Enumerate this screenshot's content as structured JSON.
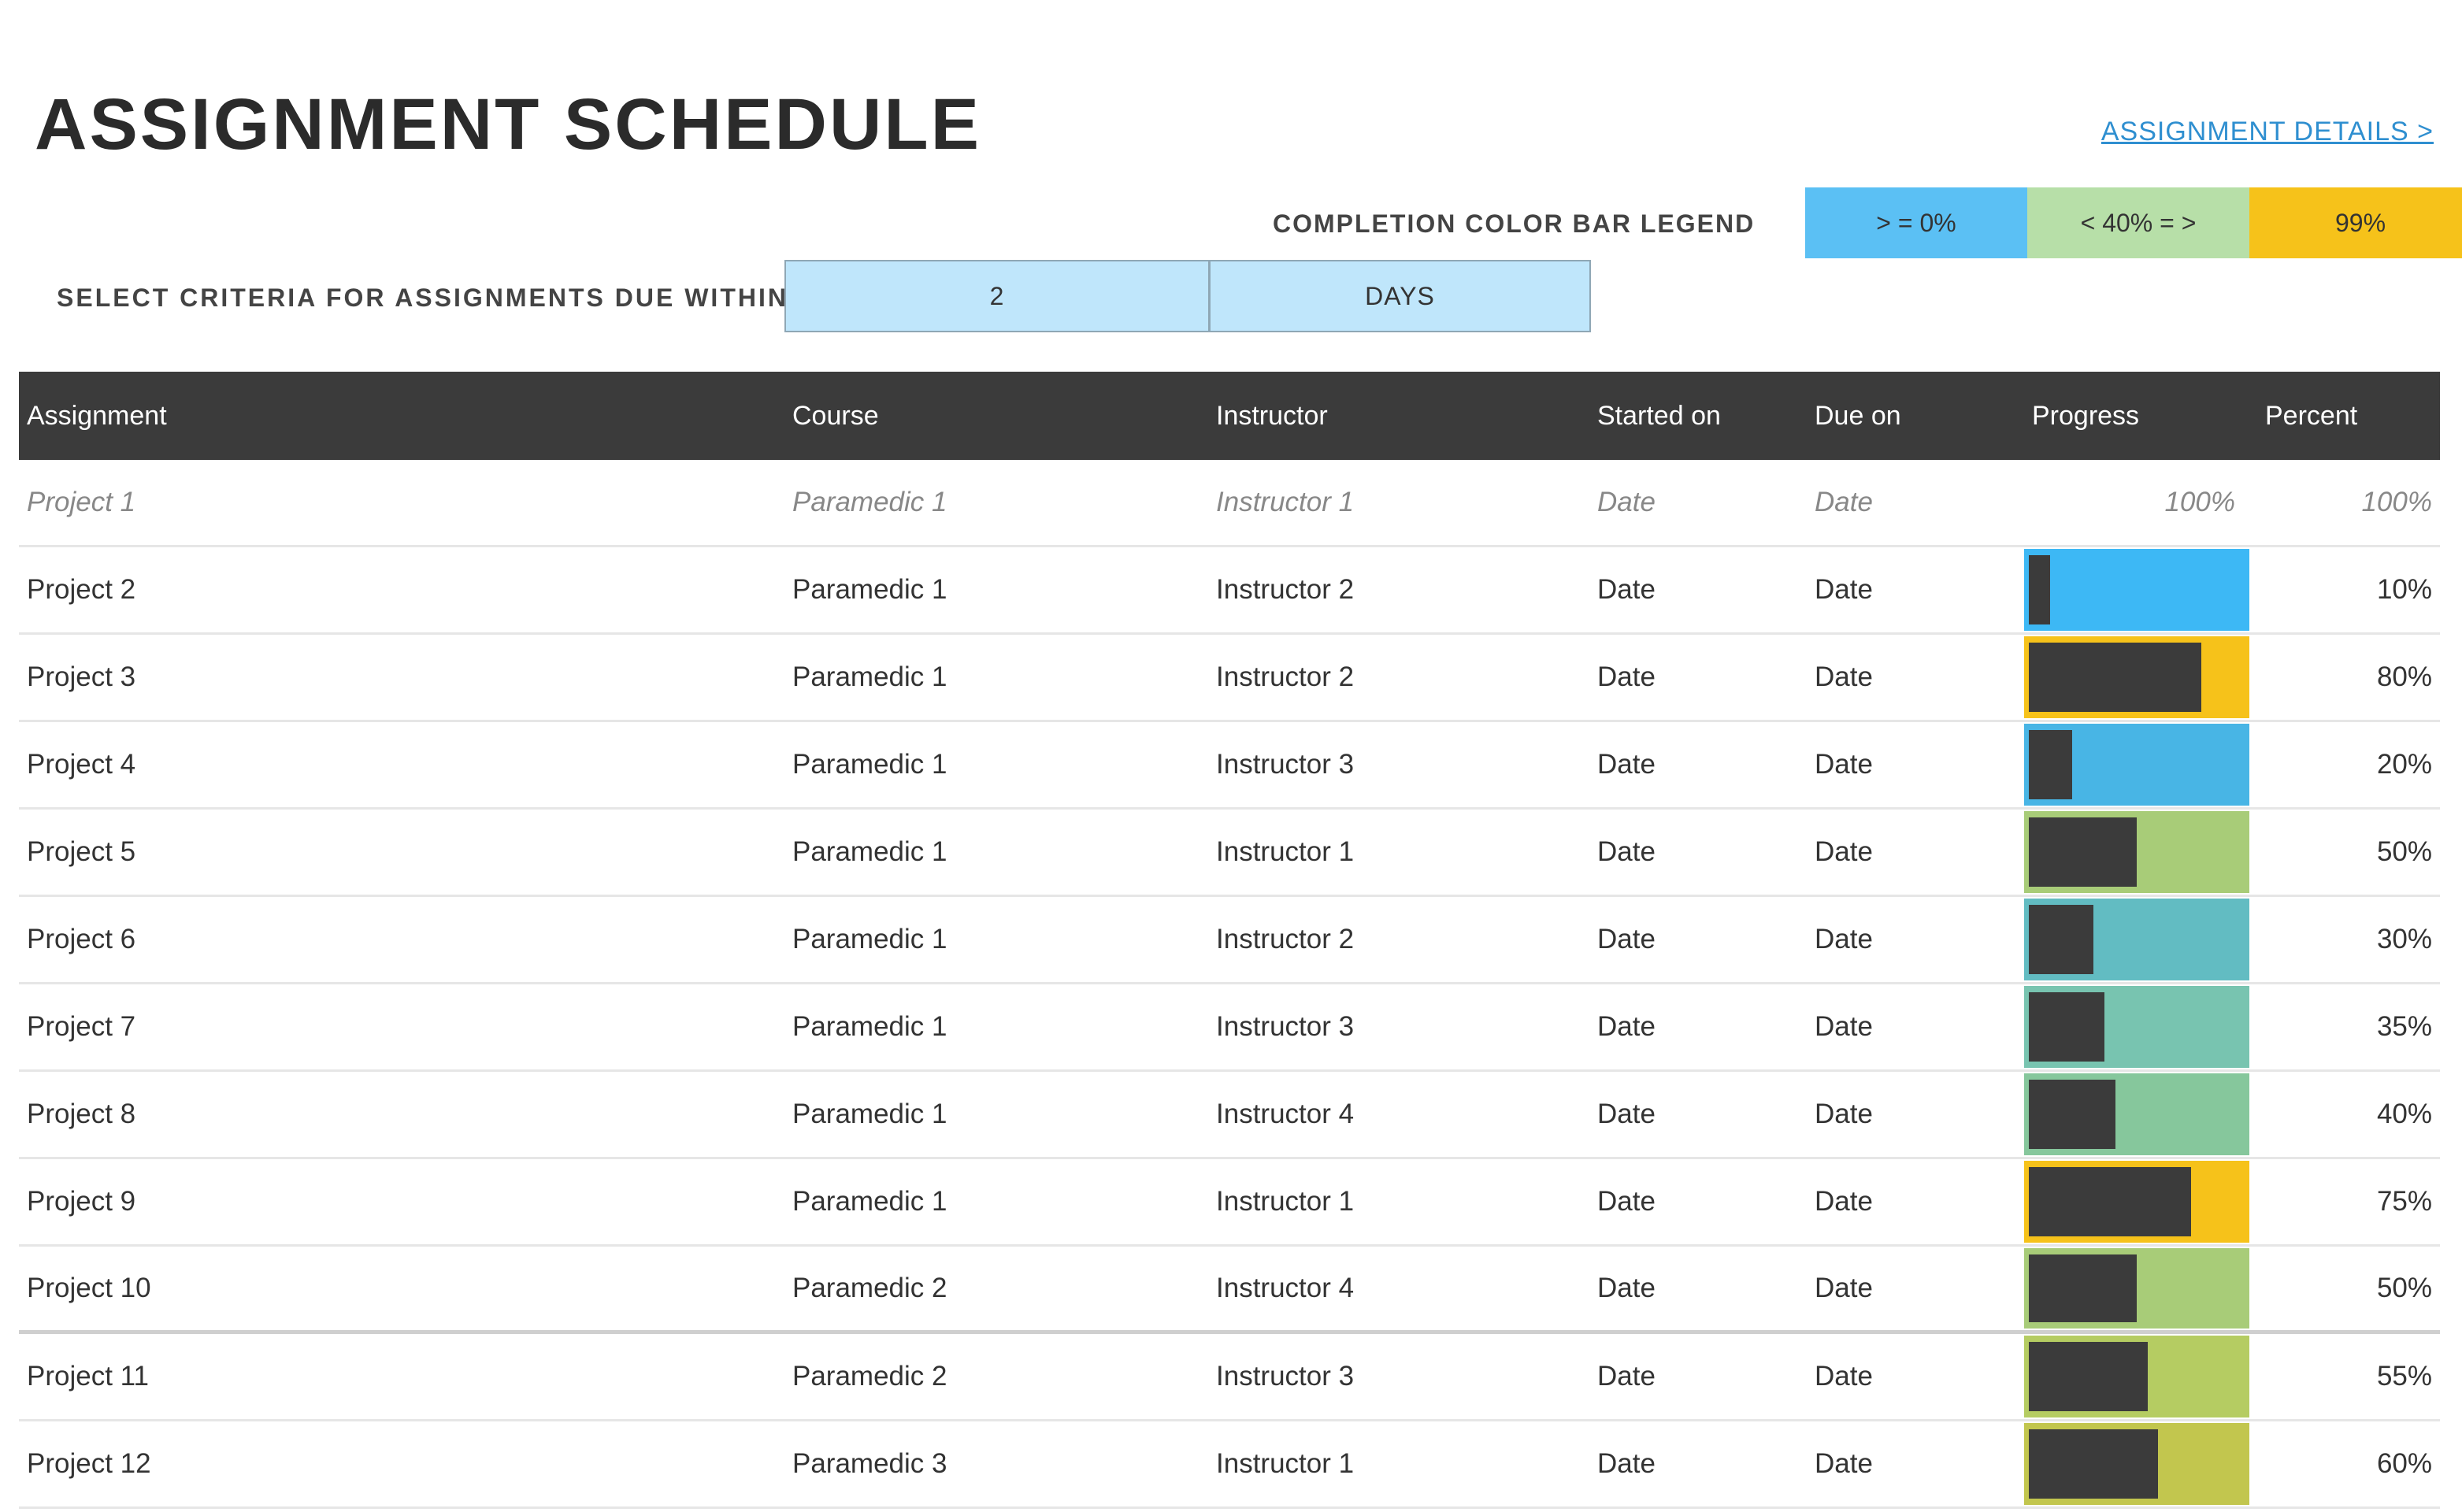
{
  "header": {
    "title": "ASSIGNMENT SCHEDULE",
    "details_link": "ASSIGNMENT DETAILS >"
  },
  "legend": {
    "label": "COMPLETION COLOR BAR LEGEND",
    "items": [
      {
        "label": "> = 0%",
        "color": "#5bc0f4"
      },
      {
        "label": "< 40% = >",
        "color": "#b7dfa8"
      },
      {
        "label": "99%",
        "color": "#f6c21a"
      }
    ]
  },
  "criteria": {
    "label": "SELECT CRITERIA FOR ASSIGNMENTS DUE WITHIN:",
    "value": "2",
    "unit": "DAYS"
  },
  "table": {
    "headers": {
      "assignment": "Assignment",
      "course": "Course",
      "instructor": "Instructor",
      "started": "Started on",
      "due": "Due on",
      "progress": "Progress",
      "percent": "Percent"
    },
    "sample_row": {
      "assignment": "Project 1",
      "course": "Paramedic 1",
      "instructor": "Instructor 1",
      "started": "Date",
      "due": "Date",
      "progress": "100%",
      "percent": "100%"
    },
    "rows": [
      {
        "assignment": "Project 2",
        "course": "Paramedic 1",
        "instructor": "Instructor 2",
        "started": "Date",
        "due": "Date",
        "percent": "10%",
        "progress": 0.1,
        "bar_color": "#3db8f5"
      },
      {
        "assignment": "Project 3",
        "course": "Paramedic 1",
        "instructor": "Instructor 2",
        "started": "Date",
        "due": "Date",
        "percent": "80%",
        "progress": 0.8,
        "bar_color": "#f6c21a"
      },
      {
        "assignment": "Project 4",
        "course": "Paramedic 1",
        "instructor": "Instructor 3",
        "started": "Date",
        "due": "Date",
        "percent": "20%",
        "progress": 0.2,
        "bar_color": "#48b5e5"
      },
      {
        "assignment": "Project 5",
        "course": "Paramedic 1",
        "instructor": "Instructor 1",
        "started": "Date",
        "due": "Date",
        "percent": "50%",
        "progress": 0.5,
        "bar_color": "#a8cc78"
      },
      {
        "assignment": "Project 6",
        "course": "Paramedic 1",
        "instructor": "Instructor 2",
        "started": "Date",
        "due": "Date",
        "percent": "30%",
        "progress": 0.3,
        "bar_color": "#62bcc2"
      },
      {
        "assignment": "Project 7",
        "course": "Paramedic 1",
        "instructor": "Instructor 3",
        "started": "Date",
        "due": "Date",
        "percent": "35%",
        "progress": 0.35,
        "bar_color": "#78c4b0"
      },
      {
        "assignment": "Project 8",
        "course": "Paramedic 1",
        "instructor": "Instructor 4",
        "started": "Date",
        "due": "Date",
        "percent": "40%",
        "progress": 0.4,
        "bar_color": "#86c79c"
      },
      {
        "assignment": "Project 9",
        "course": "Paramedic 1",
        "instructor": "Instructor 1",
        "started": "Date",
        "due": "Date",
        "percent": "75%",
        "progress": 0.75,
        "bar_color": "#f6c21a"
      },
      {
        "assignment": "Project 10",
        "course": "Paramedic 2",
        "instructor": "Instructor 4",
        "started": "Date",
        "due": "Date",
        "percent": "50%",
        "progress": 0.5,
        "bar_color": "#a8cc78"
      },
      {
        "assignment": "Project 11",
        "course": "Paramedic 2",
        "instructor": "Instructor 3",
        "started": "Date",
        "due": "Date",
        "percent": "55%",
        "progress": 0.55,
        "bar_color": "#b5cc62"
      },
      {
        "assignment": "Project 12",
        "course": "Paramedic 3",
        "instructor": "Instructor 1",
        "started": "Date",
        "due": "Date",
        "percent": "60%",
        "progress": 0.6,
        "bar_color": "#c2c64e"
      }
    ]
  }
}
